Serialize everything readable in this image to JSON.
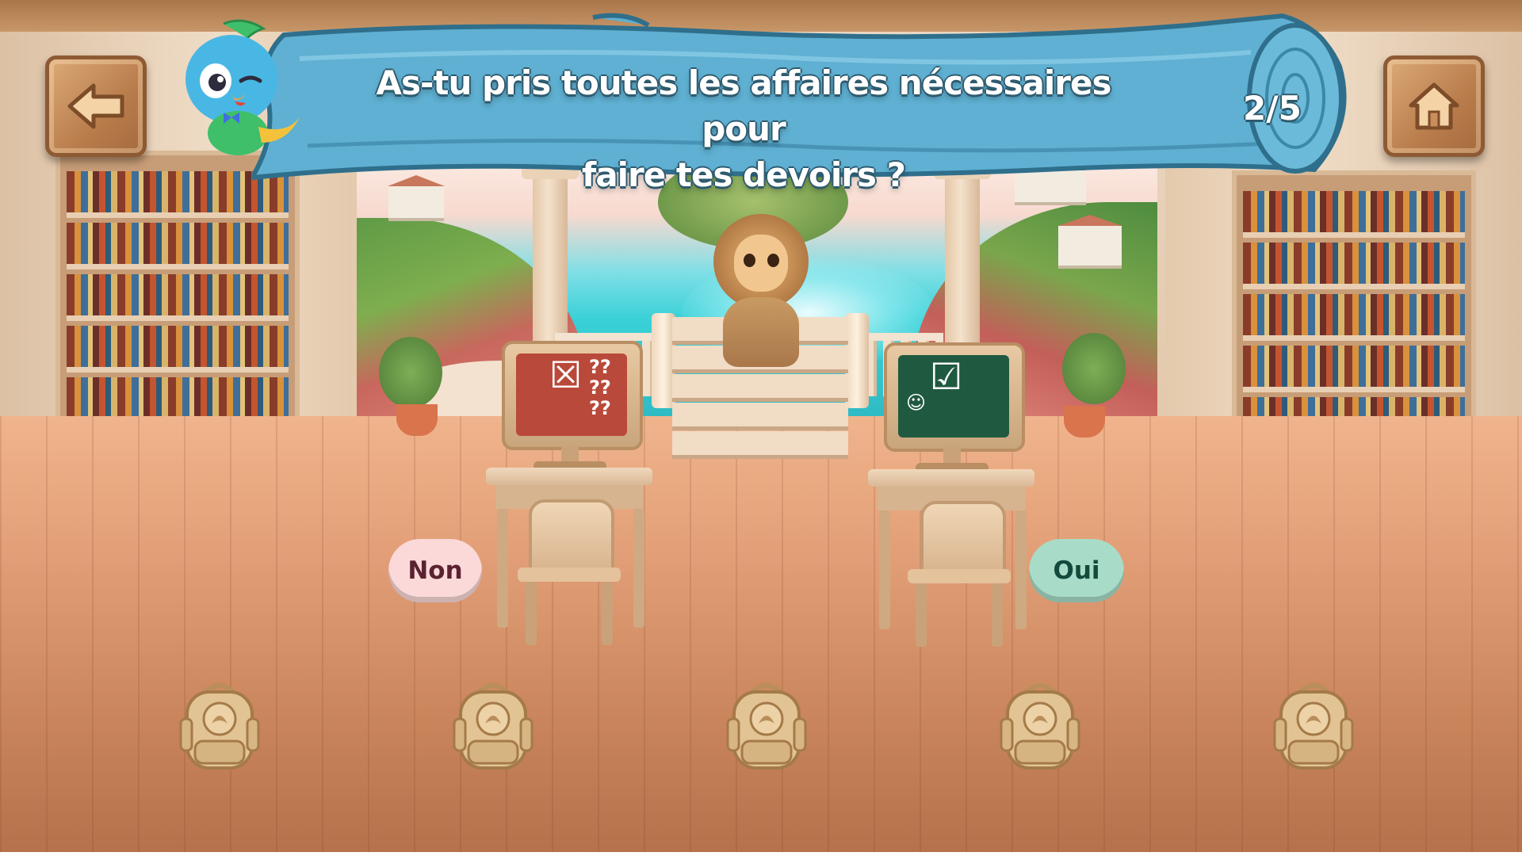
{
  "question": {
    "line1": "As-tu pris toutes les affaires nécessaires pour",
    "line2": "faire tes devoirs ?"
  },
  "progress": {
    "label": "2/5",
    "current": 2,
    "total": 5
  },
  "nav": {
    "back_icon": "arrow-left-icon",
    "home_icon": "house-icon"
  },
  "mascots": {
    "guide": "parrot",
    "scene_character": "lion"
  },
  "answers": {
    "no": "Non",
    "yes": "Oui"
  },
  "colors": {
    "banner": "#5fb0d2",
    "no_button": "#fbd9d9",
    "yes_button": "#a8dcc8",
    "no_board": "#b9493a",
    "yes_board": "#1f5a40"
  },
  "backpacks": [
    {
      "icon": "backpack-icon",
      "filled": false
    },
    {
      "icon": "backpack-icon",
      "filled": false
    },
    {
      "icon": "backpack-icon",
      "filled": false
    },
    {
      "icon": "backpack-icon",
      "filled": false
    },
    {
      "icon": "backpack-icon",
      "filled": false
    }
  ]
}
